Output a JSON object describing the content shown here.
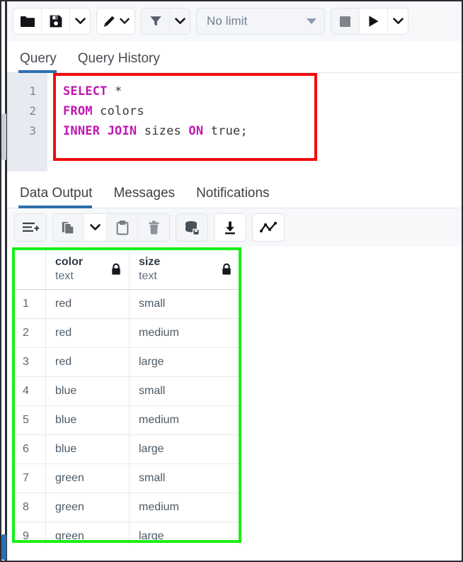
{
  "toolbar": {
    "open_file_label": "open-file",
    "save_file_label": "save-file",
    "save_dropdown_label": "save-options",
    "edit_label": "edit",
    "edit_dropdown_label": "edit-options",
    "filter_label": "filter",
    "filter_dropdown_label": "filter-options",
    "row_limit_value": "No limit",
    "stop_label": "stop",
    "execute_label": "execute",
    "execute_dropdown_label": "execute-options"
  },
  "query_tabs": [
    {
      "label": "Query",
      "active": true
    },
    {
      "label": "Query History",
      "active": false
    }
  ],
  "editor": {
    "line_numbers": [
      "1",
      "2",
      "3"
    ],
    "lines": [
      [
        {
          "t": "SELECT",
          "kw": true
        },
        {
          "t": " *",
          "kw": false
        }
      ],
      [
        {
          "t": "FROM",
          "kw": true
        },
        {
          "t": " colors",
          "kw": false
        }
      ],
      [
        {
          "t": "INNER JOIN",
          "kw": true
        },
        {
          "t": " sizes ",
          "kw": false
        },
        {
          "t": "ON",
          "kw": true
        },
        {
          "t": " true;",
          "kw": false
        }
      ]
    ],
    "plain_text": "SELECT *\nFROM colors\nINNER JOIN sizes ON true;",
    "keyword_color": "#c016b0",
    "text_color": "#36383e",
    "highlight_box_color": "#f30c0c"
  },
  "output_tabs": [
    {
      "label": "Data Output",
      "active": true
    },
    {
      "label": "Messages",
      "active": false
    },
    {
      "label": "Notifications",
      "active": false
    }
  ],
  "result_toolbar": {
    "add_row_label": "add-row",
    "copy_label": "copy",
    "copy_dropdown_label": "copy-options",
    "paste_label": "paste",
    "delete_label": "delete",
    "save_data_label": "save-data-changes",
    "download_label": "download-as-csv",
    "graph_label": "graph-visualiser"
  },
  "grid": {
    "highlight_box_color": "#18f018",
    "columns": [
      {
        "name": "",
        "type": "",
        "locked": false
      },
      {
        "name": "color",
        "type": "text",
        "locked": true
      },
      {
        "name": "size",
        "type": "text",
        "locked": true
      }
    ],
    "rows": [
      {
        "n": "1",
        "color": "red",
        "size": "small"
      },
      {
        "n": "2",
        "color": "red",
        "size": "medium"
      },
      {
        "n": "3",
        "color": "red",
        "size": "large"
      },
      {
        "n": "4",
        "color": "blue",
        "size": "small"
      },
      {
        "n": "5",
        "color": "blue",
        "size": "medium"
      },
      {
        "n": "6",
        "color": "blue",
        "size": "large"
      },
      {
        "n": "7",
        "color": "green",
        "size": "small"
      },
      {
        "n": "8",
        "color": "green",
        "size": "medium"
      },
      {
        "n": "9",
        "color": "green",
        "size": "large"
      }
    ]
  }
}
